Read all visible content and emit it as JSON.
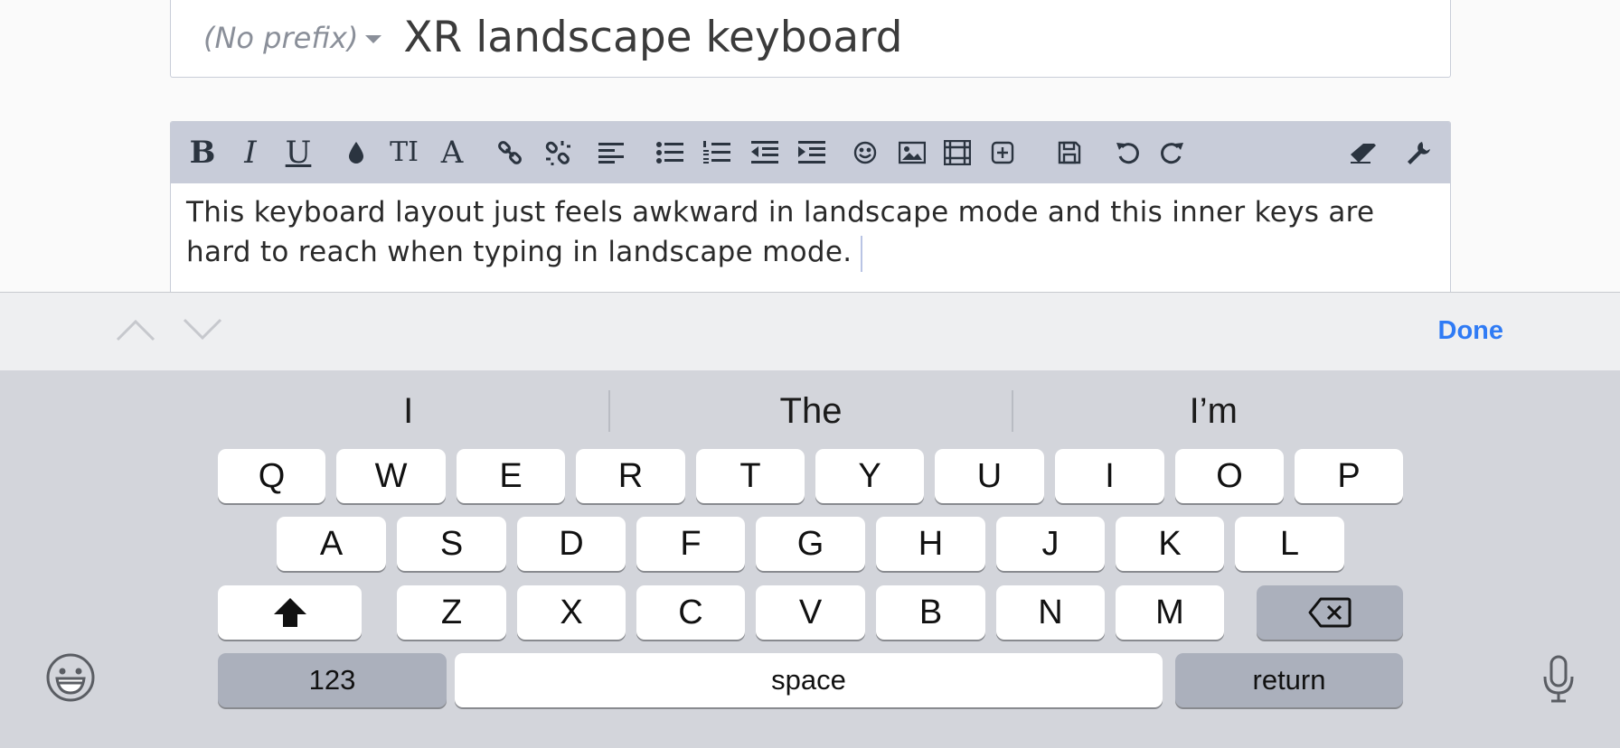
{
  "title_bar": {
    "prefix_label": "(No prefix)",
    "title_value": "XR landscape keyboard"
  },
  "toolbar": {
    "items": [
      "bold-icon",
      "italic-icon",
      "underline-icon",
      "color-icon",
      "font-size-icon",
      "font-family-icon",
      "link-icon",
      "unlink-icon",
      "align-icon",
      "bullet-list-icon",
      "numbered-list-icon",
      "outdent-icon",
      "indent-icon",
      "emoji-icon",
      "image-icon",
      "media-icon",
      "insert-icon",
      "save-draft-icon",
      "undo-icon",
      "redo-icon",
      "remove-format-icon",
      "tools-icon"
    ],
    "bold_label": "B",
    "italic_label": "I",
    "underline_label": "U",
    "font_size_label": "TI",
    "font_family_label": "A"
  },
  "editor": {
    "text": "This keyboard layout just feels awkward in landscape mode and this inner keys are hard to reach when typing in landscape mode."
  },
  "accessory_bar": {
    "done_label": "Done"
  },
  "keyboard": {
    "suggestions": [
      "I",
      "The",
      "I’m"
    ],
    "row1": [
      "Q",
      "W",
      "E",
      "R",
      "T",
      "Y",
      "U",
      "I",
      "O",
      "P"
    ],
    "row2": [
      "A",
      "S",
      "D",
      "F",
      "G",
      "H",
      "J",
      "K",
      "L"
    ],
    "row3": [
      "Z",
      "X",
      "C",
      "V",
      "B",
      "N",
      "M"
    ],
    "numbers_label": "123",
    "space_label": "space",
    "return_label": "return",
    "colors": {
      "background": "#d3d5db",
      "key": "#ffffff",
      "dark_key": "#abb0bc",
      "accent": "#2f7bf5"
    }
  }
}
